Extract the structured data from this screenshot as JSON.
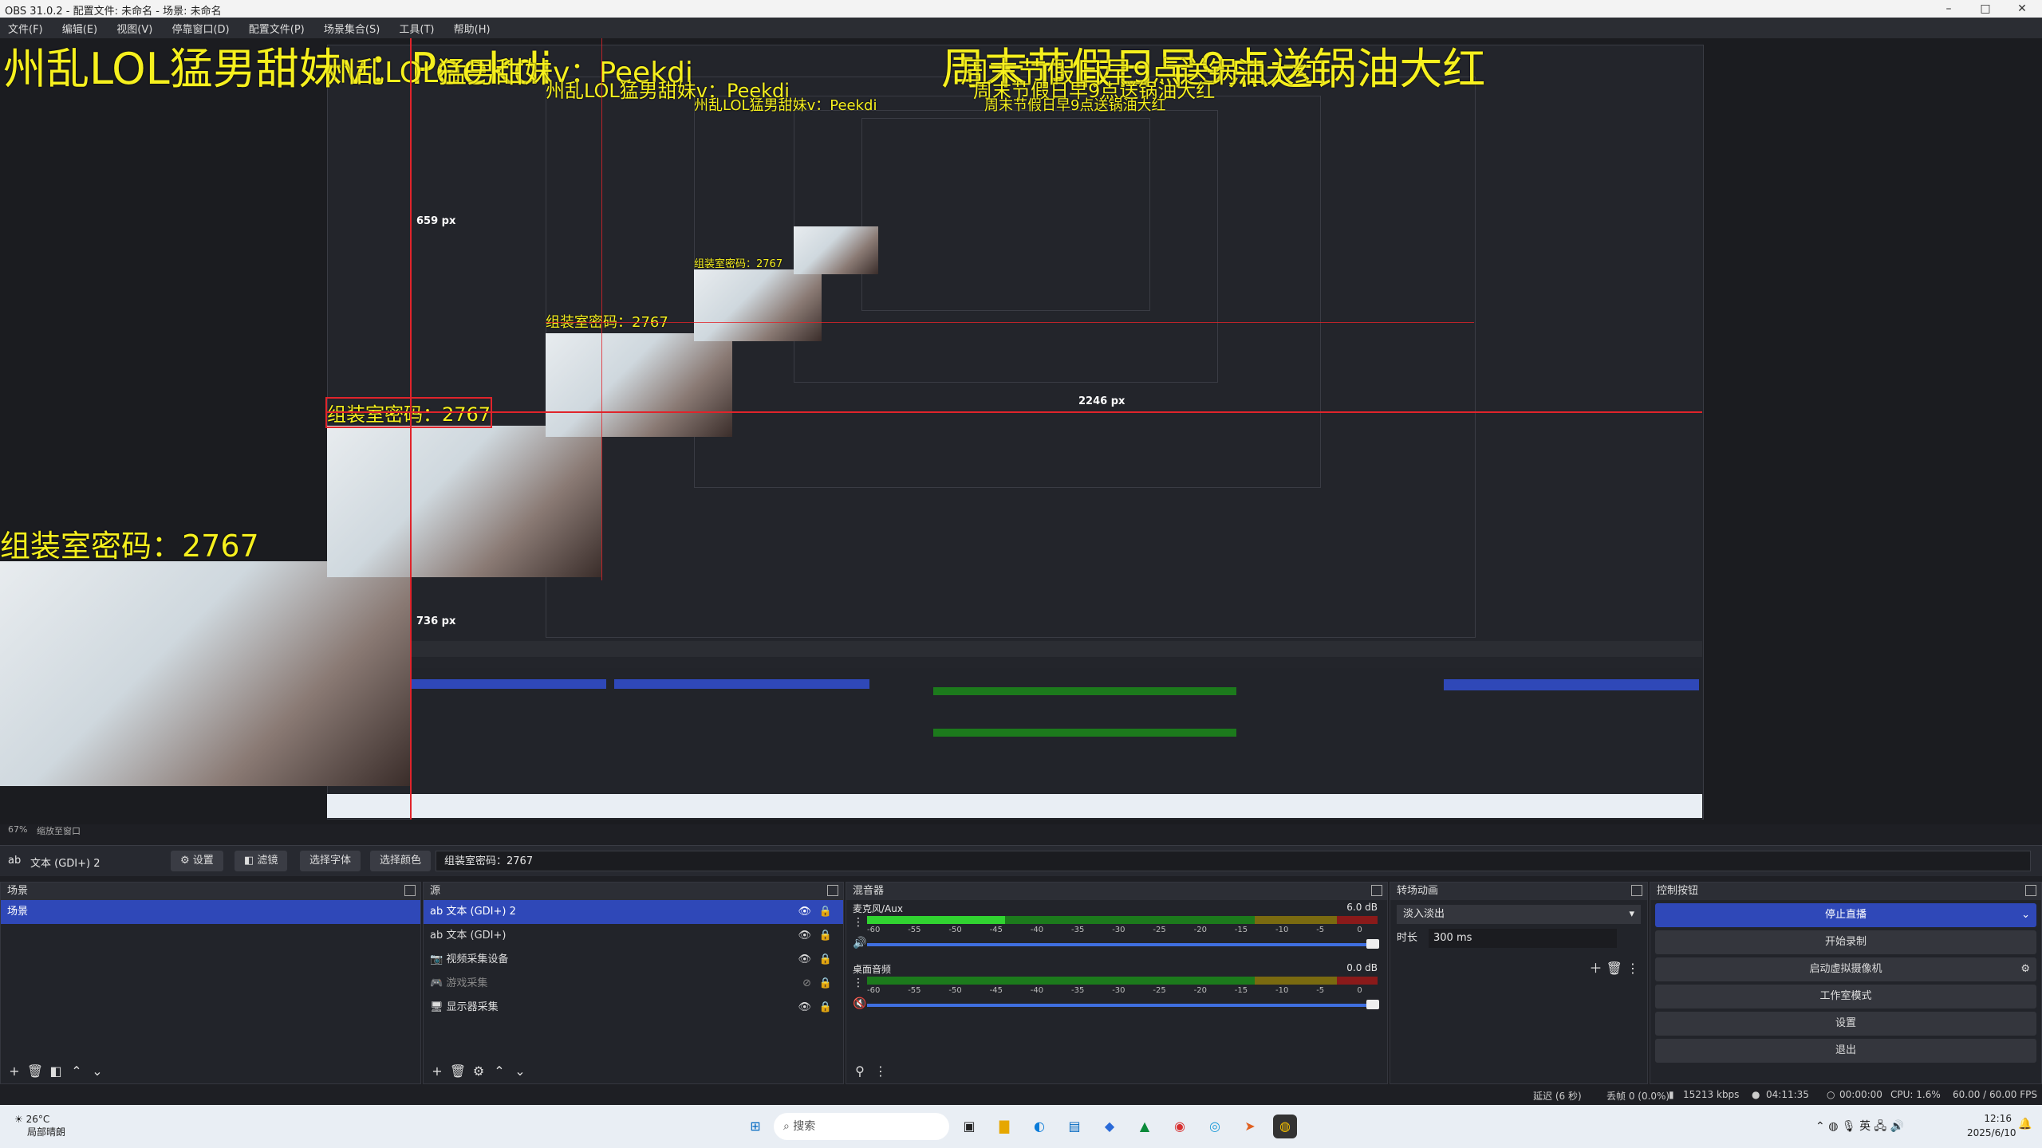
{
  "window": {
    "title": "OBS 31.0.2 - 配置文件: 未命名 - 场景: 未命名"
  },
  "menu": [
    "文件(F)",
    "编辑(E)",
    "视图(V)",
    "停靠窗口(D)",
    "配置文件(P)",
    "场景集合(S)",
    "工具(T)",
    "帮助(H)"
  ],
  "preview": {
    "top_left_text": "州乱LOL猛男甜妹v：Peekdi",
    "top_right_text": "周末节假日早9点送锅油大红",
    "room_text": "组装室密码：2767",
    "measure_h": "659 px",
    "measure_w": "736 px",
    "measure_2246": "2246 px"
  },
  "zoom_bar": {
    "zoom": "67%",
    "mode": "缩放至窗口"
  },
  "context": {
    "source_name": "文本 (GDI+) 2",
    "btn_settings": "设置",
    "btn_filters": "滤镜",
    "btn_font": "选择字体",
    "btn_color": "选择颜色",
    "text_value": "组装室密码：2767"
  },
  "scenes": {
    "title": "场景",
    "items": [
      "场景"
    ]
  },
  "sources": {
    "title": "源",
    "items": [
      {
        "label": "文本 (GDI+) 2",
        "icon": "text-icon"
      },
      {
        "label": "文本 (GDI+)",
        "icon": "text-icon"
      },
      {
        "label": "视频采集设备",
        "icon": "camera-icon"
      },
      {
        "label": "游戏采集",
        "icon": "gamepad-icon"
      },
      {
        "label": "显示器采集",
        "icon": "monitor-icon"
      }
    ]
  },
  "mixer": {
    "title": "混音器",
    "channels": [
      {
        "name": "麦克风/Aux",
        "db": "6.0 dB",
        "level": 0.27
      },
      {
        "name": "桌面音频",
        "db": "0.0 dB",
        "level": 0
      }
    ],
    "ticks": [
      "-60",
      "-55",
      "-50",
      "-45",
      "-40",
      "-35",
      "-30",
      "-25",
      "-20",
      "-15",
      "-10",
      "-5",
      "0"
    ]
  },
  "transitions": {
    "title": "转场动画",
    "type": "淡入淡出",
    "duration_label": "时长",
    "duration": "300 ms"
  },
  "controls": {
    "title": "控制按钮",
    "buttons": [
      "停止直播",
      "开始录制",
      "启动虚拟摄像机",
      "工作室模式",
      "设置",
      "退出"
    ]
  },
  "status": {
    "delay": "延迟 (6 秒)",
    "dropped": "丢帧 0 (0.0%)",
    "bitrate": "15213 kbps",
    "live_time": "04:11:35",
    "rec_time": "00:00:00",
    "cpu": "CPU: 1.6%",
    "fps": "60.00 / 60.00 FPS"
  },
  "taskbar": {
    "weather_temp": "26°C",
    "weather_desc": "局部晴朗",
    "search": "搜索",
    "ime": "英",
    "time": "12:16",
    "date": "2025/6/10"
  },
  "colors": {
    "accent": "#2f48b8",
    "overlay_yellow": "#f6f01e",
    "guide_red": "#e0242b"
  }
}
